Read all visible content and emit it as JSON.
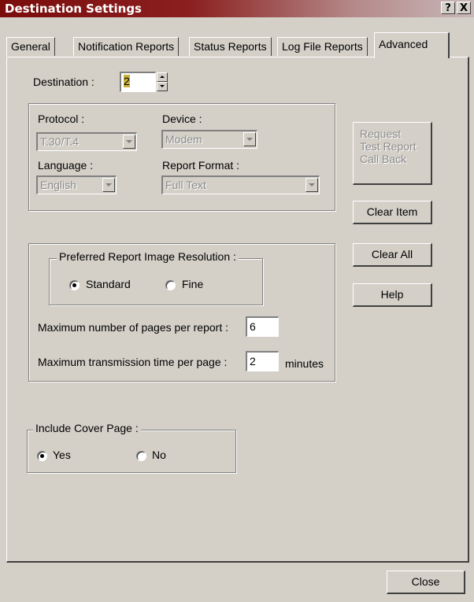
{
  "window": {
    "title": "Destination Settings",
    "help_glyph": "?",
    "close_glyph": "X"
  },
  "tabs": [
    {
      "label": "General",
      "active": false
    },
    {
      "label": "Notification Reports",
      "active": false
    },
    {
      "label": "Status Reports",
      "active": false
    },
    {
      "label": "Log File Reports",
      "active": false
    },
    {
      "label": "Advanced",
      "active": true
    }
  ],
  "destination": {
    "label": "Destination :",
    "value": "2"
  },
  "protocol": {
    "label": "Protocol :",
    "value": "T.30/T.4"
  },
  "device": {
    "label": "Device :",
    "value": "Modem"
  },
  "language": {
    "label": "Language :",
    "value": "English"
  },
  "report_format": {
    "label": "Report Format :",
    "value": "Full Text"
  },
  "buttons": {
    "request_line1": "Request",
    "request_line2": "Test Report",
    "request_line3": "Call Back",
    "clear_item": "Clear Item",
    "clear_all": "Clear All",
    "help": "Help",
    "close": "Close"
  },
  "resolution": {
    "legend": "Preferred Report Image Resolution :",
    "standard": "Standard",
    "fine": "Fine",
    "selected": "Standard"
  },
  "max_pages": {
    "label": "Maximum number of pages per report :",
    "value": "6"
  },
  "max_time": {
    "label": "Maximum transmission time per page :",
    "value": "2",
    "unit": "minutes"
  },
  "cover_page": {
    "legend": "Include Cover Page :",
    "yes": "Yes",
    "no": "No",
    "selected": "Yes"
  }
}
